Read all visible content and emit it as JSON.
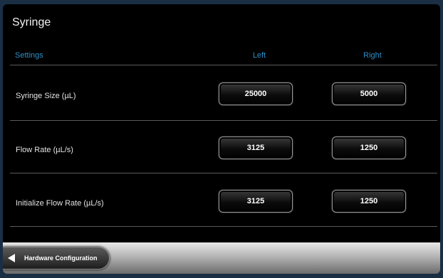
{
  "screen": {
    "title": "Syringe"
  },
  "table": {
    "headers": {
      "settings": "Settings",
      "left": "Left",
      "right": "Right"
    },
    "rows": [
      {
        "label": "Syringe Size (µL)",
        "left": "25000",
        "right": "5000"
      },
      {
        "label": "Flow Rate (µL/s)",
        "left": "3125",
        "right": "1250"
      },
      {
        "label": "Initialize Flow Rate (µL/s)",
        "left": "3125",
        "right": "1250"
      }
    ]
  },
  "footer": {
    "back_label": "Hardware Configuration",
    "back_icon": "arrow-left-icon"
  }
}
